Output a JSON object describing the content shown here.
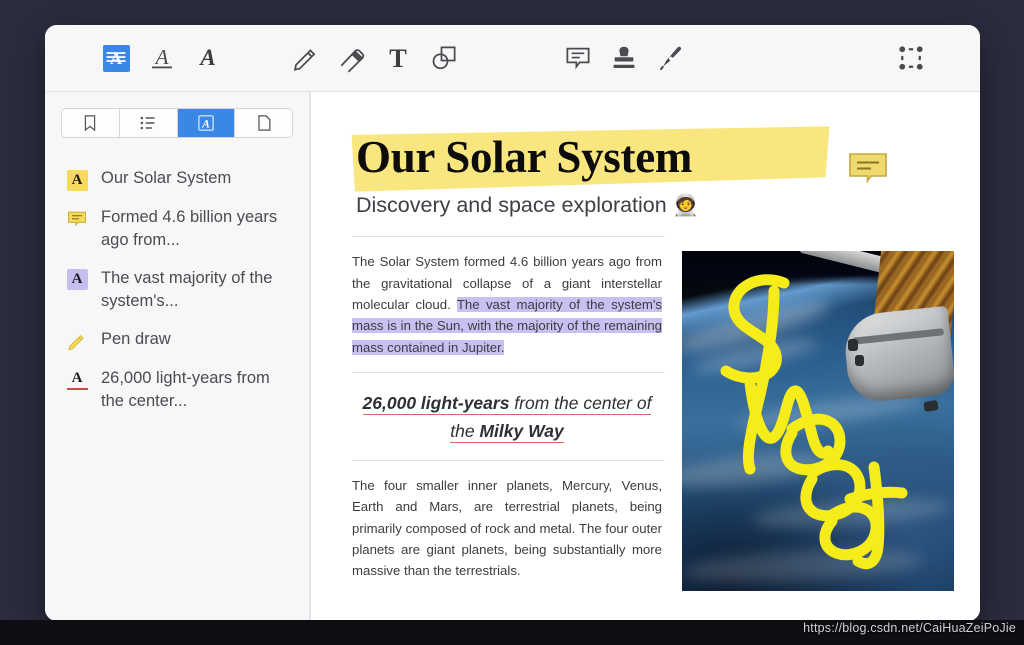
{
  "app": {
    "background_color": "#2b2c3e",
    "window_background": "#f7f7f8"
  },
  "toolbar": {
    "items": [
      {
        "name": "highlight-text-tool",
        "icon": "highlighter-a-icon",
        "label": "Highlight",
        "active": true
      },
      {
        "name": "underline-text-tool",
        "icon": "underline-a-icon",
        "label": "Underline",
        "active": false
      },
      {
        "name": "strikethrough-text-tool",
        "icon": "strikethrough-a-icon",
        "label": "Strikethrough",
        "active": false
      },
      {
        "name": "pencil-tool",
        "icon": "pencil-icon",
        "label": "Pencil",
        "active": false
      },
      {
        "name": "eraser-tool",
        "icon": "eraser-icon",
        "label": "Eraser",
        "active": false
      },
      {
        "name": "text-tool",
        "icon": "text-t-icon",
        "label": "Text",
        "active": false
      },
      {
        "name": "shapes-tool",
        "icon": "shapes-icon",
        "label": "Shapes",
        "active": false
      },
      {
        "name": "comment-tool",
        "icon": "comment-bubble-icon",
        "label": "Comment",
        "active": false
      },
      {
        "name": "stamp-tool",
        "icon": "stamp-icon",
        "label": "Stamp",
        "active": false
      },
      {
        "name": "signature-tool",
        "icon": "fountain-pen-icon",
        "label": "Signature",
        "active": false
      },
      {
        "name": "snapshot-tool",
        "icon": "selection-box-icon",
        "label": "Snapshot",
        "active": false
      }
    ],
    "active_color": "#3b87e4"
  },
  "sidebar": {
    "tabs": [
      {
        "name": "tab-bookmarks",
        "icon": "bookmark-icon",
        "label": "Bookmarks",
        "active": false
      },
      {
        "name": "tab-outline",
        "icon": "list-icon",
        "label": "Outline",
        "active": false
      },
      {
        "name": "tab-annotations",
        "icon": "letter-a-icon",
        "label": "Annotations",
        "active": true
      },
      {
        "name": "tab-pages",
        "icon": "page-icon",
        "label": "Pages",
        "active": false
      }
    ],
    "annotations": [
      {
        "icon": "highlight-a-icon",
        "icon_style": "yellow",
        "text": "Our Solar System"
      },
      {
        "icon": "comment-bubble-icon",
        "icon_style": "yellow",
        "text": "Formed 4.6 billion years ago from..."
      },
      {
        "icon": "highlight-a-icon",
        "icon_style": "purple",
        "text": "The vast majority of the system's..."
      },
      {
        "icon": "pencil-icon",
        "icon_style": "yellow",
        "text": "Pen draw"
      },
      {
        "icon": "underline-a-icon",
        "icon_style": "red",
        "text": "26,000 light-years from the center..."
      }
    ]
  },
  "document": {
    "title": "Our Solar System",
    "title_highlight_color": "#fae473",
    "subtitle": "Discovery and space exploration",
    "subtitle_emoji": "🧑‍🚀",
    "comment_marker": "comment-bubble-annotation",
    "paragraph_1": {
      "plain_start": "The Solar System formed 4.6 billion years ago from the gravitational collapse of a giant interstellar molecular cloud. ",
      "highlighted": "The vast majority of the system's mass is in the Sun, with the majority of the remaining mass contained in Jupiter.",
      "highlight_color": "#c9c0f2"
    },
    "quote": {
      "bold_lead": "26,000 light-years",
      "middle": " from the center of the ",
      "bold_tail": "Milky Way",
      "underline_color": "#d06a63"
    },
    "paragraph_2": "The four smaller inner planets, Mercury, Venus, Earth and Mars, are terrestrial planets, being primarily composed of rock and metal. The four outer planets are giant planets, being substantially more massive than the terrestrials.",
    "image": {
      "name": "earth-from-space-photo",
      "alt": "Spacecraft orbiting above Earth",
      "ink_annotation_text": "Sweet",
      "ink_color": "#f5ec1a"
    }
  },
  "watermark": "https://blog.csdn.net/CaiHuaZeiPoJie"
}
